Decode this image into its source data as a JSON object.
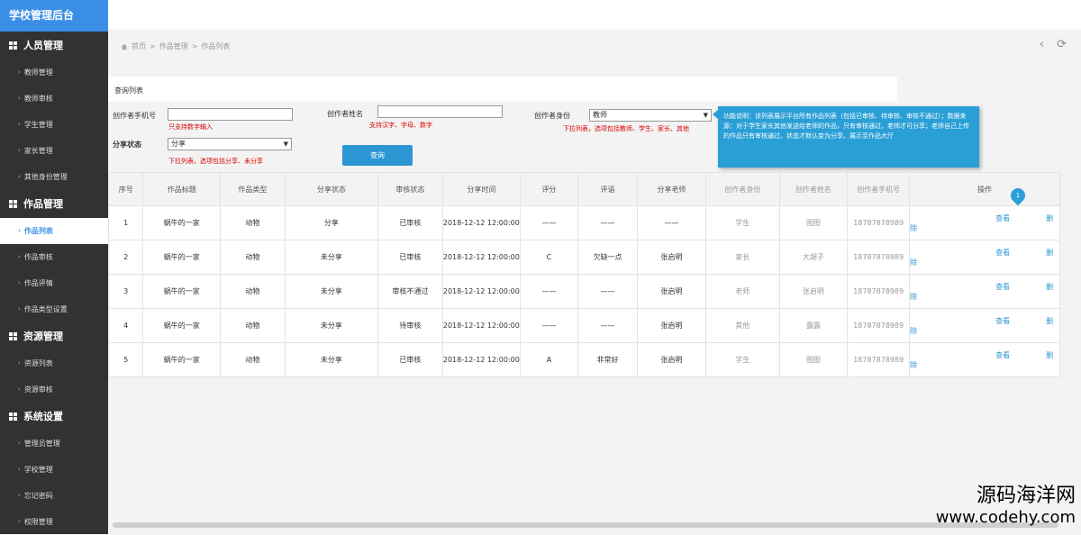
{
  "sidebar": {
    "brand": "学校管理后台",
    "groups": [
      {
        "label": "人员管理",
        "items": [
          "教师管理",
          "教师审核",
          "学生管理",
          "家长管理",
          "其他身份管理"
        ]
      },
      {
        "label": "作品管理",
        "items": [
          "作品列表",
          "作品审核",
          "作品评情",
          "作品类型设置"
        ]
      },
      {
        "label": "资源管理",
        "items": [
          "资源列表",
          "资源审核"
        ]
      },
      {
        "label": "系统设置",
        "items": [
          "管理员管理",
          "学校管理",
          "忘记密码",
          "权限管理"
        ]
      }
    ],
    "active_item": "作品列表"
  },
  "breadcrumb": {
    "home": "首页",
    "level1": "作品管理",
    "level2": "作品列表",
    "sep": ">"
  },
  "nav": {
    "back": "‹",
    "refresh": "⟳"
  },
  "query": {
    "title": "查询列表",
    "phone_label": "创作者手机号",
    "phone_hint": "只支持数字输入",
    "name_label": "创作者姓名",
    "name_hint": "支持汉字、字母、数字",
    "identity_label": "创作者身份",
    "identity_value": "教师",
    "identity_hint": "下拉列表，选项包括教师、学生、家长、其他",
    "share_label": "分享状态",
    "share_value": "分享",
    "share_hint": "下拉列表，选项包括分享、未分享",
    "query_button": "查询"
  },
  "tip": {
    "text": "功能说明：该列表展示平台所有作品列表（包括已审核、待审核、审核不通过）；数据来源：对于学生家长其他发送给老师的作品，只有审核通过，老师才可分享；老师自己上传的作品只有审核通过，状态才默认变为分享。展示至作品大厅"
  },
  "table": {
    "headers": [
      "序号",
      "作品标题",
      "作品类型",
      "分享状态",
      "审核状态",
      "分享时间",
      "评分",
      "评语",
      "分享老师",
      "创作者身份",
      "创作者姓名",
      "创作者手机号",
      "操作"
    ],
    "view_label": "查看",
    "delete_label": "删除",
    "rows": [
      [
        "1",
        "蜗牛的一家",
        "动物",
        "分享",
        "已审核",
        "2018-12-12 12:00:00",
        "——",
        "——",
        "——",
        "学生",
        "图图",
        "18787878989"
      ],
      [
        "2",
        "蜗牛的一家",
        "动物",
        "未分享",
        "已审核",
        "2018-12-12 12:00:00",
        "C",
        "欠缺一点",
        "张启明",
        "家长",
        "大胡子",
        "18787878989"
      ],
      [
        "3",
        "蜗牛的一家",
        "动物",
        "未分享",
        "审核不通过",
        "2018-12-12 12:00:00",
        "——",
        "——",
        "张启明",
        "老师",
        "张启明",
        "18787878989"
      ],
      [
        "4",
        "蜗牛的一家",
        "动物",
        "未分享",
        "待审核",
        "2018-12-12 12:00:00",
        "——",
        "——",
        "张启明",
        "其他",
        "露露",
        "18787878989"
      ],
      [
        "5",
        "蜗牛的一家",
        "动物",
        "未分享",
        "已审核",
        "2018-12-12 12:00:00",
        "A",
        "非常好",
        "张启明",
        "学生",
        "图图",
        "18787878989"
      ]
    ]
  },
  "pin_marker": "1",
  "watermark": {
    "line1": "源码海洋网",
    "line2": "www.codehy.com"
  }
}
